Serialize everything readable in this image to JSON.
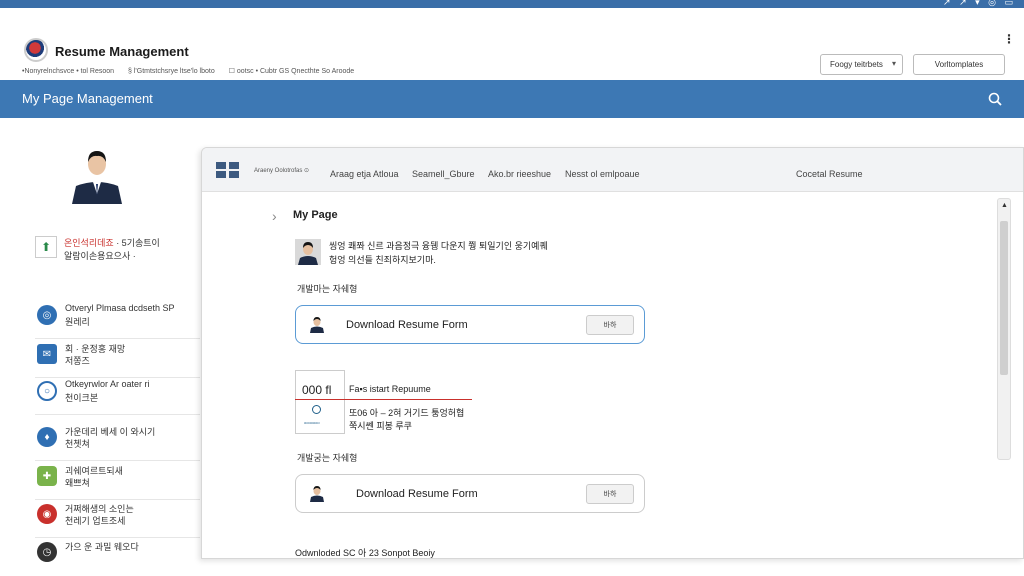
{
  "top_strip": {
    "glyphs": "↗ ↗ ▾ ◎ ▭"
  },
  "header": {
    "app_title": "Resume Management",
    "subline": [
      "•Nonyrelnchsvce • tol Resoon",
      "§ l'Gtmtstchsrye ltse'lo lboto",
      "☐ ootsc • Cubtr GS Qnecthte So Aroode"
    ],
    "kebab": "⋮",
    "select_value": "Foogy teitrbets",
    "button_label": "Vorltomplates"
  },
  "bluebar": {
    "title": "My Page Management"
  },
  "sidebar": {
    "profile_icon": "home-arrow-icon",
    "profile_name": "온인석리데죠",
    "profile_line1_rest": " · 5기송트이",
    "profile_line2": "알람이손용요으사 ·",
    "menu": [
      {
        "icon": "target-icon",
        "color": "#2f6fb3",
        "line1": "Otveryl Plmasa dcdseth SP",
        "line2": "원레리"
      },
      {
        "icon": "mail-icon",
        "color": "#2f6fb3",
        "line1": "회 · 운정홍 재망",
        "line2": "저쫑즈"
      },
      {
        "icon": "search-icon",
        "color": "#2f6fb3",
        "line1": "Otkeyrwlor Ar oater ri",
        "line2": "천이크본"
      },
      {
        "icon": "pin-icon",
        "color": "#2f6fb3",
        "line1": "가운데리 베세 이 와시기",
        "line2": "천쳇쳐"
      },
      {
        "icon": "puzzle-icon",
        "color": "#7ab34b",
        "line1": "괴쉐여르트되새",
        "line2": "왜쁘쳐"
      },
      {
        "icon": "bullseye-icon",
        "color": "#c9302c",
        "line1": "거쩌해생의 소인는",
        "line2": "천레기 업트조세"
      },
      {
        "icon": "clock-icon",
        "color": "#333333",
        "line1": "가으 운 과밀 웨오다",
        "line2": ""
      }
    ]
  },
  "panel": {
    "tabs": {
      "small": "Araeny Oolotrofas ⊙",
      "items": [
        "Araag etja Atloua",
        "Seamell_Gbure",
        "Ako.br rieeshue",
        "Nesst ol emlpoaue",
        "Cocetal Resume"
      ]
    },
    "breadcrumb_chevron": "›",
    "page_title": "My Page",
    "intro_line1": "씽엉 쾌쫘 신르 과음정극 융뒝 다운지 쭹 퇴일기인 웅기예퀘",
    "intro_line2": "헝엉 의선들 친죄하지보기마.",
    "section1_label": "개발마는 자쉐형",
    "card1": {
      "label": "Download Resume Form",
      "button": "바하"
    },
    "stat": {
      "number": "000 fl",
      "caption": "ooooooo",
      "title": "Fa▪s istart Repuume",
      "line1": "또06 아 – 2혀 거기드 퉁엉허협",
      "line2": "쭉시쎈 피봉 루쿠"
    },
    "section2_label": "개발궁는 자쉐형",
    "card2": {
      "label": "Download Resume Form",
      "button": "바하"
    },
    "footer_line": "Odwnloded SC 아 23 Sonpot Beoiy",
    "scroll_up": "▲"
  }
}
